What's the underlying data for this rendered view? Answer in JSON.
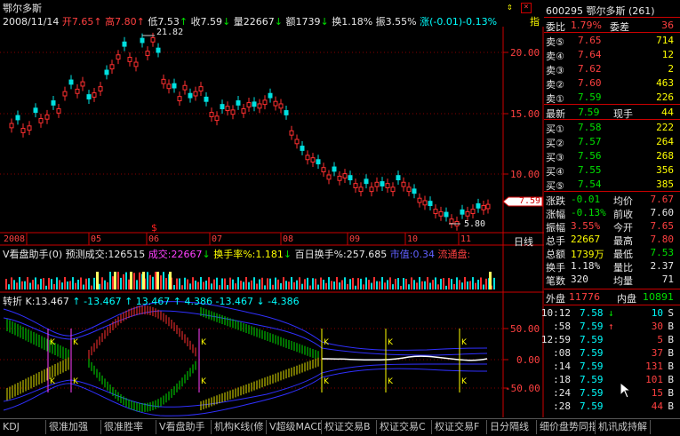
{
  "header": {
    "stock_name": "鄂尔多斯",
    "date": "2008/11/14",
    "open": "开7.65",
    "high": "高7.80",
    "low": "低7.53",
    "close": "收7.59",
    "volume": "量22667",
    "amount": "额1739",
    "turnover": "换1.18%",
    "amplitude": "振3.55%",
    "change": "涨(-0.01)-0.13%",
    "indicator_label": "指"
  },
  "price_chart": {
    "y_labels": [
      "20.00",
      "15.00",
      "10.00"
    ],
    "current_price_label": "7.59",
    "high_marker": "21.82",
    "low_marker": "5.80",
    "date_labels": [
      "2008",
      "05",
      "06",
      "07",
      "08",
      "09",
      "10",
      "11"
    ],
    "period_label": "日线"
  },
  "volume_panel": {
    "title": "V看盘助手(0)",
    "forecast": "预测成交:126515",
    "volume": "成交:22667",
    "turnover_rate": "换手率%:1.181",
    "hundred_day_turnover": "百日换手%:257.685",
    "other1": "市值:0.34",
    "other2": "流通盘:"
  },
  "indicator_panel": {
    "title": "转折",
    "k_value": "K:13.467",
    "values": "↑ -13.467 ↑ 13.467 ↑ 4.386 -13.467 ↓ -4.386",
    "y_labels": [
      "50.00",
      "0.00",
      "-50.00"
    ]
  },
  "quote_panel": {
    "code": "600295",
    "name": "鄂尔多斯",
    "number": "(261)",
    "weibi_label": "委比",
    "weibi_value": "1.79%",
    "weicha_label": "委差",
    "weicha_value": "36",
    "sells": [
      {
        "label": "卖⑤",
        "price": "7.65",
        "vol": "714"
      },
      {
        "label": "卖④",
        "price": "7.64",
        "vol": "12"
      },
      {
        "label": "卖③",
        "price": "7.62",
        "vol": "2"
      },
      {
        "label": "卖②",
        "price": "7.60",
        "vol": "463"
      },
      {
        "label": "卖①",
        "price": "7.59",
        "vol": "226"
      }
    ],
    "latest_label": "最新",
    "latest_price": "7.59",
    "xianshou_label": "现手",
    "xianshou_value": "44",
    "buys": [
      {
        "label": "买①",
        "price": "7.58",
        "vol": "222"
      },
      {
        "label": "买②",
        "price": "7.57",
        "vol": "264"
      },
      {
        "label": "买③",
        "price": "7.56",
        "vol": "268"
      },
      {
        "label": "买④",
        "price": "7.55",
        "vol": "356"
      },
      {
        "label": "买⑤",
        "price": "7.54",
        "vol": "385"
      }
    ],
    "stats": [
      {
        "l1": "涨跌",
        "v1": "-0.01",
        "l2": "均价",
        "v2": "7.67"
      },
      {
        "l1": "涨幅",
        "v1": "-0.13%",
        "l2": "前收",
        "v2": "7.60"
      },
      {
        "l1": "振幅",
        "v1": "3.55%",
        "l2": "今开",
        "v2": "7.65"
      },
      {
        "l1": "总手",
        "v1": "22667",
        "l2": "最高",
        "v2": "7.80"
      },
      {
        "l1": "总额",
        "v1": "1739万",
        "l2": "最低",
        "v2": "7.53"
      },
      {
        "l1": "换手",
        "v1": "1.18%",
        "l2": "量比",
        "v2": "2.37"
      },
      {
        "l1": "笔数",
        "v1": "320",
        "l2": "均量",
        "v2": "71"
      }
    ],
    "waipan_label": "外盘",
    "waipan_value": "11776",
    "neipan_label": "内盘",
    "neipan_value": "10891"
  },
  "ticks": [
    {
      "time": "10:12",
      "price": "7.58",
      "arrow": "↓",
      "vol": "10",
      "side": "S"
    },
    {
      "time": ":58",
      "price": "7.59",
      "arrow": "↑",
      "vol": "30",
      "side": "B"
    },
    {
      "time": "12:59",
      "price": "7.59",
      "arrow": "",
      "vol": "5",
      "side": "B"
    },
    {
      "time": ":08",
      "price": "7.59",
      "arrow": "",
      "vol": "37",
      "side": "B"
    },
    {
      "time": ":14",
      "price": "7.59",
      "arrow": "",
      "vol": "131",
      "side": "B"
    },
    {
      "time": ":18",
      "price": "7.59",
      "arrow": "",
      "vol": "101",
      "side": "B"
    },
    {
      "time": ":24",
      "price": "7.59",
      "arrow": "",
      "vol": "15",
      "side": "B"
    },
    {
      "time": ":28",
      "price": "7.59",
      "arrow": "",
      "vol": "44",
      "side": "B"
    }
  ],
  "tabs": [
    "KDJ",
    "很准加强",
    "很准胜率",
    "V看盘助手",
    "机构K线(修",
    "V超级MACD",
    "权证交易B",
    "权证交易C",
    "权证交易F",
    "日分隔线",
    "细价盘势同指",
    "机讯成持解"
  ]
}
